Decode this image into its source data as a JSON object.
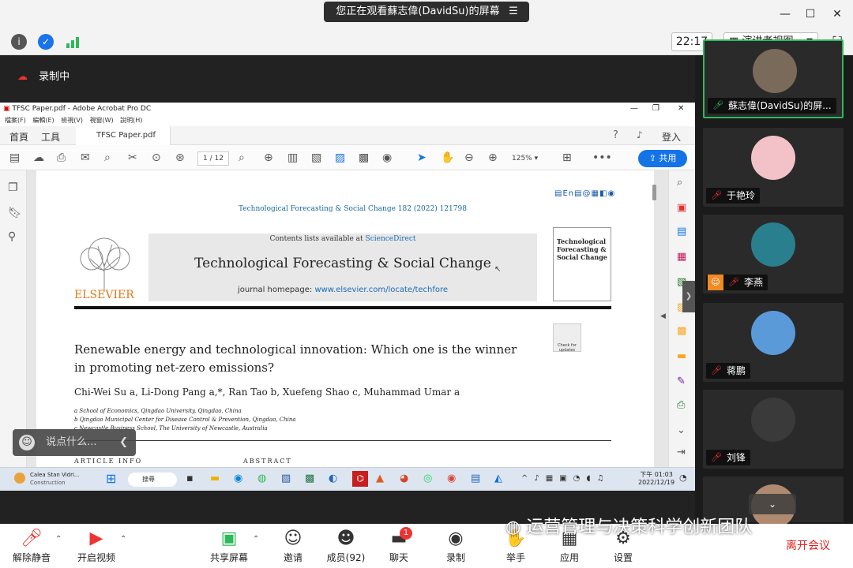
{
  "top": {
    "sharing_text": "您正在观看蘇志偉(DavidSu)的屏幕"
  },
  "info": {
    "time": "22:17",
    "view_label": "演讲者视图"
  },
  "recording": {
    "label": "录制中"
  },
  "acrobat": {
    "title": "TFSC Paper.pdf - Adobe Acrobat Pro DC",
    "menu": "檔案(F) 編輯(E) 檢視(V) 視窗(W) 說明(H)",
    "tab_home": "首頁",
    "tab_tools": "工具",
    "tab_doc": "TFSC Paper.pdf",
    "login": "登入",
    "page_current": "1",
    "page_total": "/ 12",
    "zoom": "125%",
    "share": "共用"
  },
  "paper": {
    "journal_ref": "Technological Forecasting & Social Change 182 (2022) 121798",
    "contents": "Contents lists available at",
    "sciencedirect": "ScienceDirect",
    "journal_name": "Technological Forecasting & Social Change",
    "homepage": "journal homepage:",
    "homepage_url": "www.elsevier.com/locate/techfore",
    "publisher": "ELSEVIER",
    "cover_title": "Technological Forecasting & Social Change",
    "check_updates": "Check for updates",
    "title_line1": "Renewable energy and technological innovation: Which one is the winner",
    "title_line2": "in promoting net-zero emissions?",
    "authors": "Chi-Wei Su a, Li-Dong Pang a,*, Ran Tao b, Xuefeng Shao c, Muhammad Umar a",
    "aff_a": "a School of Economics, Qingdao University, Qingdao, China",
    "aff_b": "b Qingdao Municipal Center for Disease Control & Prevention, Qingdao, China",
    "aff_c": "c Newcastle Business School, The University of Newcastle, Australia",
    "article_info": "ARTICLE INFO",
    "abstract": "ABSTRACT"
  },
  "taskbar": {
    "news_title": "Calea Stan Vidri...",
    "news_sub": "Construction",
    "search": "搜尋",
    "time": "下午 01:03",
    "date": "2022/12/19"
  },
  "chat": {
    "placeholder": "说点什么..."
  },
  "participants": [
    {
      "name": "蘇志偉(DavidSu)的屏..."
    },
    {
      "name": "于艳玲"
    },
    {
      "name": "李燕"
    },
    {
      "name": "蒋鹏"
    },
    {
      "name": "刘锋"
    }
  ],
  "bottom": {
    "mute": "解除静音",
    "video": "开启视频",
    "share": "共享屏幕",
    "invite": "邀请",
    "members": "成员(92)",
    "chat": "聊天",
    "chat_badge": "1",
    "record": "录制",
    "raise": "举手",
    "apps": "应用",
    "settings": "设置",
    "leave": "离开会议"
  },
  "watermark": "运营管理与决策科学创新团队"
}
